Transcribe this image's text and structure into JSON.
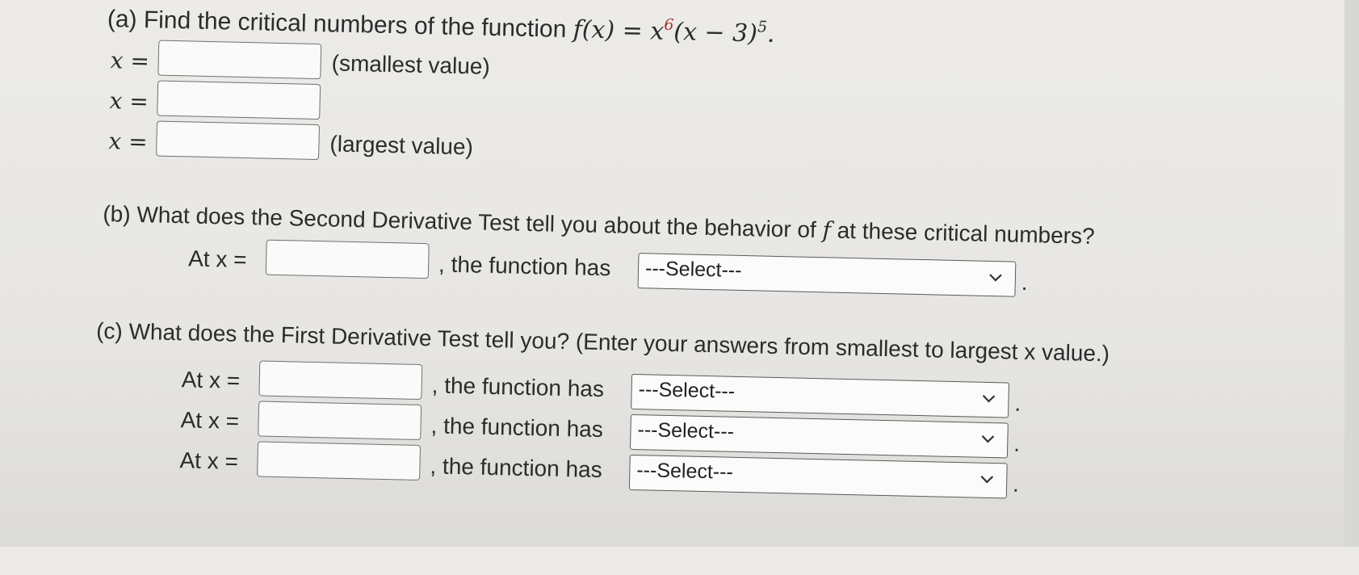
{
  "part_a": {
    "question": "(a) Find the critical numbers of the function ",
    "func_lhs": "f(x) = x",
    "exp6": "6",
    "func_mid": "(x − 3)",
    "exp5": "5",
    "func_end": ".",
    "rows": [
      {
        "label": "x =",
        "suffix": "(smallest value)"
      },
      {
        "label": "x =",
        "suffix": ""
      },
      {
        "label": "x =",
        "suffix": "(largest value)"
      }
    ]
  },
  "part_b": {
    "question_start": "(b) What does the Second Derivative Test tell you about the behavior of ",
    "question_f": "f",
    "question_end": " at these critical numbers?",
    "row": {
      "label": "At x =",
      "middle": ", the function has",
      "select": "---Select---",
      "end": "."
    }
  },
  "part_c": {
    "question": "(c) What does the First Derivative Test tell you? (Enter your answers from smallest to largest x value.)",
    "rows": [
      {
        "label": "At x =",
        "middle": ", the function has",
        "select": "---Select---",
        "end": "."
      },
      {
        "label": "At x =",
        "middle": ", the function has",
        "select": "---Select---",
        "end": "."
      },
      {
        "label": "At x =",
        "middle": ", the function has",
        "select": "---Select---",
        "end": "."
      }
    ]
  },
  "colors": {
    "exponent_red": "#a8322a",
    "text": "#2b2b2b"
  }
}
